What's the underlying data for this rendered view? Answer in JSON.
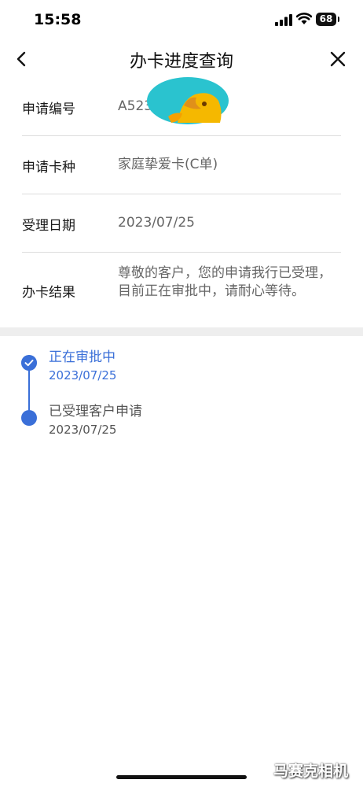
{
  "status_bar": {
    "time": "15:58",
    "battery": "68"
  },
  "nav": {
    "title": "办卡进度查询"
  },
  "info": [
    {
      "label": "申请编号",
      "value": "A523"
    },
    {
      "label": "申请卡种",
      "value": "家庭挚爱卡(C单)"
    },
    {
      "label": "受理日期",
      "value": "2023/07/25"
    },
    {
      "label": "办卡结果",
      "value": "尊敬的客户，您的申请我行已受理，目前正在审批中，请耐心等待。"
    }
  ],
  "timeline": [
    {
      "title": "正在审批中",
      "date": "2023/07/25",
      "active": true
    },
    {
      "title": "已受理客户申请",
      "date": "2023/07/25",
      "active": false
    }
  ],
  "colors": {
    "accent": "#3a6fd8",
    "separator": "#eeeeee",
    "redaction_cyan": "#2ac3cf",
    "redaction_yellow": "#f5b800"
  },
  "watermark": "马赛克相机"
}
